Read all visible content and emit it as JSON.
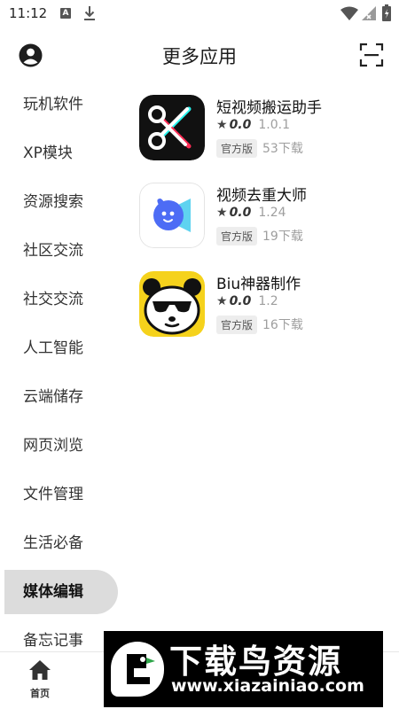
{
  "status_bar": {
    "time": "11:12",
    "notification_letter": "A",
    "icons": [
      "a-notification-icon",
      "download-icon",
      "wifi-icon",
      "cellular-icon",
      "battery-icon"
    ]
  },
  "header": {
    "title": "更多应用",
    "profile_icon": "account-circle-icon",
    "scan_icon": "scan-icon"
  },
  "sidebar": {
    "items": [
      {
        "label": "玩机软件",
        "active": false
      },
      {
        "label": "XP模块",
        "active": false
      },
      {
        "label": "资源搜索",
        "active": false
      },
      {
        "label": "社区交流",
        "active": false
      },
      {
        "label": "社交交流",
        "active": false
      },
      {
        "label": "人工智能",
        "active": false
      },
      {
        "label": "云端储存",
        "active": false
      },
      {
        "label": "网页浏览",
        "active": false
      },
      {
        "label": "文件管理",
        "active": false
      },
      {
        "label": "生活必备",
        "active": false
      },
      {
        "label": "媒体编辑",
        "active": true
      },
      {
        "label": "备忘记事",
        "active": false
      }
    ]
  },
  "apps": [
    {
      "name": "短视频搬运助手",
      "rating": "0.0",
      "version": "1.0.1",
      "badge": "官方版",
      "downloads": "53下载",
      "icon": "scissors-app-icon"
    },
    {
      "name": "视频去重大师",
      "rating": "0.0",
      "version": "1.24",
      "badge": "官方版",
      "downloads": "19下载",
      "icon": "video-dedupe-app-icon"
    },
    {
      "name": "Biu神器制作",
      "rating": "0.0",
      "version": "1.2",
      "badge": "官方版",
      "downloads": "16下载",
      "icon": "panda-app-icon"
    }
  ],
  "rating_symbol": "★",
  "bottom_nav": {
    "home_label": "首页",
    "home_icon": "home-icon"
  },
  "watermark": {
    "title": "下载鸟资源",
    "url": "www.xiazainiao.com"
  },
  "colors": {
    "active_category_bg": "#dcdcdc",
    "badge_bg": "#ededed",
    "muted_text": "#9e9e9e",
    "app2_accent": "#4d6cf5",
    "app3_bg": "#f5d21c"
  }
}
